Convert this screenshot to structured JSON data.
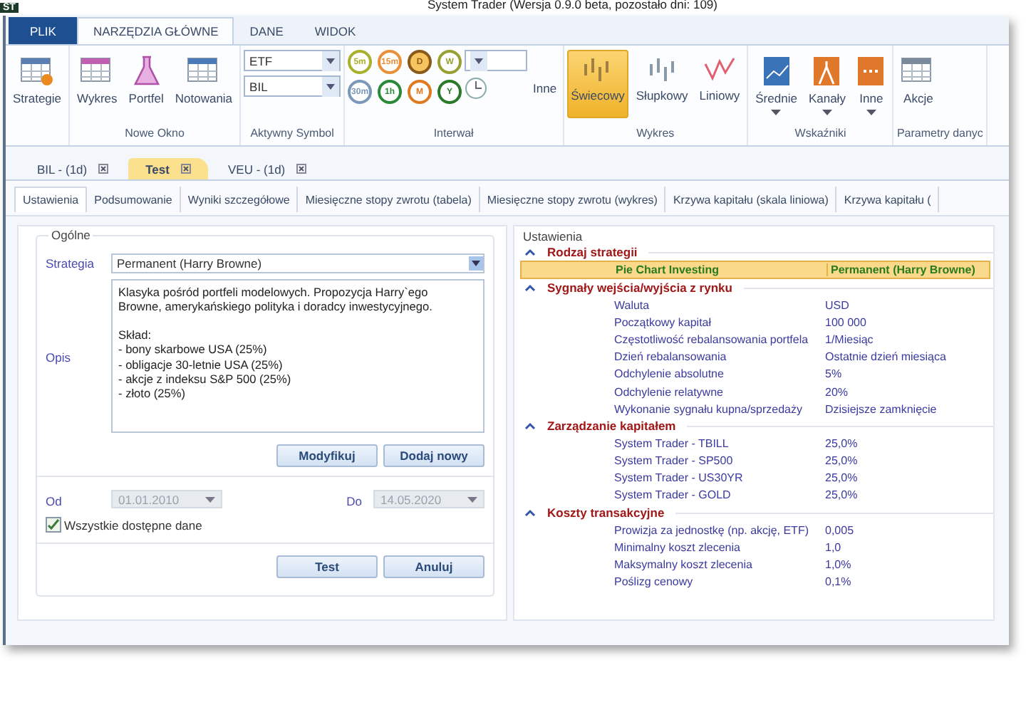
{
  "window": {
    "title": "System Trader (Wersja 0.9.0 beta, pozostało dni: 109)",
    "app_badge": "ST"
  },
  "ribbon": {
    "tabs": [
      {
        "label": "PLIK",
        "kind": "file",
        "selected": false
      },
      {
        "label": "NARZĘDZIA GŁÓWNE",
        "kind": "tab",
        "selected": true
      },
      {
        "label": "DANE",
        "kind": "tab",
        "selected": false
      },
      {
        "label": "WIDOK",
        "kind": "tab",
        "selected": false
      }
    ],
    "groups": [
      {
        "kind": "buttons",
        "items": [
          {
            "label": "Strategie"
          }
        ]
      },
      {
        "kind": "buttons",
        "label": "Nowe Okno",
        "items": [
          {
            "label": "Wykres"
          },
          {
            "label": "Portfel"
          },
          {
            "label": "Notowania"
          }
        ]
      },
      {
        "kind": "combos",
        "label": "Aktywny Symbol",
        "items": [
          {
            "value": "ETF"
          },
          {
            "value": "BIL"
          }
        ]
      },
      {
        "kind": "intervals",
        "label": "Interwał",
        "items": [
          {
            "label": "5m",
            "color": "#a8b02c",
            "selected": false
          },
          {
            "label": "15m",
            "color": "#e8903a",
            "selected": false
          },
          {
            "label": "D",
            "color": "#8a5a1a",
            "selected": true
          },
          {
            "label": "W",
            "color": "#98a032",
            "selected": false
          },
          {
            "label": "30m",
            "color": "#7a98b8",
            "selected": false
          },
          {
            "label": "1h",
            "color": "#2a8a3a",
            "selected": false
          },
          {
            "label": "M",
            "color": "#e07a20",
            "selected": false
          },
          {
            "label": "Y",
            "color": "#2a7a2a",
            "selected": false
          }
        ],
        "other": "Inne"
      },
      {
        "kind": "chart_types",
        "label": "Wykres",
        "items": [
          {
            "label": "Świecowy",
            "selected": true
          },
          {
            "label": "Słupkowy",
            "selected": false
          },
          {
            "label": "Liniowy",
            "selected": false
          }
        ]
      },
      {
        "kind": "dropdowns",
        "label": "Wskaźniki",
        "items": [
          {
            "label": "Średnie"
          },
          {
            "label": "Kanały"
          },
          {
            "label": "Inne"
          }
        ]
      },
      {
        "kind": "buttons",
        "label": "Parametry danyc",
        "items": [
          {
            "label": "Akcje"
          }
        ]
      }
    ]
  },
  "document_tabs": [
    {
      "label": "BIL - (1d)",
      "selected": false
    },
    {
      "label": "Test",
      "selected": true
    },
    {
      "label": "VEU - (1d)",
      "selected": false
    }
  ],
  "sub_tabs": [
    {
      "label": "Ustawienia",
      "selected": true
    },
    {
      "label": "Podsumowanie",
      "selected": false
    },
    {
      "label": "Wyniki szczegółowe",
      "selected": false
    },
    {
      "label": "Miesięczne stopy zwrotu (tabela)",
      "selected": false
    },
    {
      "label": "Miesięczne stopy zwrotu (wykres)",
      "selected": false
    },
    {
      "label": "Krzywa kapitału (skala liniowa)",
      "selected": false
    },
    {
      "label": "Krzywa kapitału (",
      "selected": false
    }
  ],
  "general": {
    "title": "Ogólne",
    "strategy_label": "Strategia",
    "strategy": "Permanent (Harry Browne)",
    "description_label": "Opis",
    "description": "Klasyka pośród portfeli modelowych. Propozycja Harry`ego Browne, amerykańskiego polityka i doradcy inwestycyjnego.\n\nSkład:\n- bony skarbowe USA (25%)\n- obligacje 30-letnie USA (25%)\n- akcje z indeksu S&P 500 (25%)\n- złoto (25%)",
    "edit_buttons": [
      "Modyfikuj",
      "Dodaj nowy"
    ],
    "from_label": "Od",
    "from": "01.01.2010",
    "to_label": "Do",
    "to": "14.05.2020",
    "dates_disabled": true,
    "all_data": {
      "label": "Wszystkie dostępne dane",
      "checked": true
    },
    "action_buttons": [
      "Test",
      "Anuluj"
    ]
  },
  "settings": {
    "title": "Ustawienia",
    "sections": [
      {
        "title": "Rodzaj strategii",
        "expanded": true,
        "rows": [
          {
            "name": "Pie Chart Investing",
            "value": "Permanent (Harry Browne)",
            "selected": true
          }
        ]
      },
      {
        "title": "Sygnały wejścia/wyjścia z rynku",
        "expanded": true,
        "rows": [
          {
            "name": "Waluta",
            "value": "USD",
            "selected": false
          },
          {
            "name": "Początkowy kapitał",
            "value": "100 000",
            "selected": false
          },
          {
            "name": "Częstotliwość rebalansowania portfela",
            "value": "1/Miesiąc",
            "selected": false
          },
          {
            "name": "Dzień rebalansowania",
            "value": "Ostatnie dzień miesiąca",
            "selected": false
          },
          {
            "name": "Odchylenie absolutne",
            "value": "5%",
            "selected": false
          },
          {
            "name": "Odchylenie relatywne",
            "value": "20%",
            "selected": false
          },
          {
            "name": "Wykonanie sygnału kupna/sprzedaży",
            "value": "Dzisiejsze zamknięcie",
            "selected": false
          }
        ]
      },
      {
        "title": "Zarządzanie kapitałem",
        "expanded": true,
        "rows": [
          {
            "name": "System Trader - TBILL",
            "value": "25,0%",
            "selected": false
          },
          {
            "name": "System Trader - SP500",
            "value": "25,0%",
            "selected": false
          },
          {
            "name": "System Trader - US30YR",
            "value": "25,0%",
            "selected": false
          },
          {
            "name": "System Trader - GOLD",
            "value": "25,0%",
            "selected": false
          }
        ]
      },
      {
        "title": "Koszty transakcyjne",
        "expanded": true,
        "rows": [
          {
            "name": "Prowizja za jednostkę (np. akcję, ETF)",
            "value": "0,005",
            "selected": false
          },
          {
            "name": "Minimalny koszt zlecenia",
            "value": "1,0",
            "selected": false
          },
          {
            "name": "Maksymalny koszt zlecenia",
            "value": "1,0%",
            "selected": false
          },
          {
            "name": "Poślizg cenowy",
            "value": "0,1%",
            "selected": false
          }
        ]
      }
    ]
  }
}
